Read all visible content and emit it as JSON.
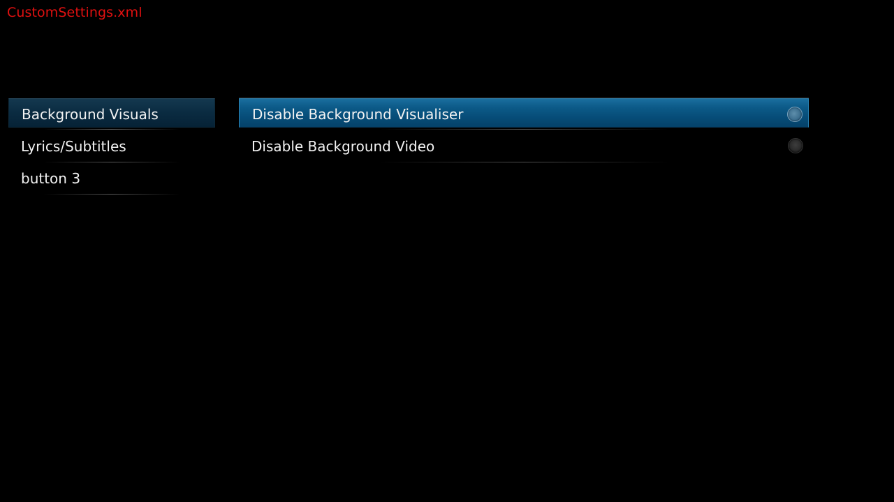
{
  "window": {
    "title": "CustomSettings.xml"
  },
  "categories": [
    {
      "label": "Background Visuals",
      "selected": true
    },
    {
      "label": "Lyrics/Subtitles",
      "selected": false
    },
    {
      "label": "button 3",
      "selected": false
    }
  ],
  "settings": [
    {
      "label": "Disable Background Visualiser",
      "selected": true,
      "enabled": false,
      "icon": "radio-button-icon"
    },
    {
      "label": "Disable Background Video",
      "selected": false,
      "enabled": false,
      "icon": "radio-button-icon"
    }
  ],
  "colors": {
    "title": "#e01010",
    "accent": "#0c5a88",
    "background": "#000000"
  }
}
